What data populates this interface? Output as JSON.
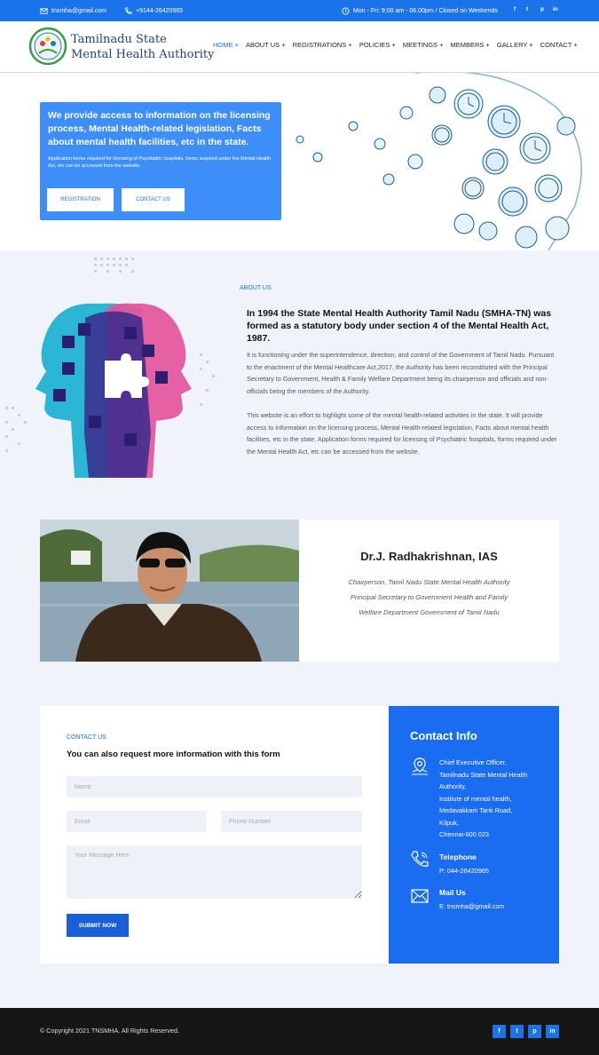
{
  "topbar": {
    "email": "tnsmha@gmail.com",
    "phone": "+9144-26420965",
    "hours": "Mon - Fri: 9:00 am - 06.00pm / Closed on Weekends",
    "social": [
      "f",
      "t",
      "p",
      "in"
    ]
  },
  "header": {
    "brand_line1": "Tamilnadu State",
    "brand_line2": "Mental Health Authority",
    "nav": [
      "HOME +",
      "ABOUT US +",
      "REGISTRATIONS +",
      "POLICIES +",
      "MEETINGS +",
      "MEMBERS +",
      "GALLERY +",
      "CONTACT +"
    ]
  },
  "hero": {
    "heading": "We provide access to information on the licensing process, Mental Health-related legislation, Facts about mental health facilities, etc in the state.",
    "text": "Application forms required for licensing of Psychiatric hospitals, forms required under the Mental Health Act, etc can be accessed from the website.",
    "btn_registration": "REGISTRATION",
    "btn_contact": "CONTACT US"
  },
  "about": {
    "subtitle": "ABOUT US",
    "heading": "In 1994 the State Mental Health Authority Tamil Nadu (SMHA-TN) was formed as a statutory body under section 4 of the Mental Health Act, 1987.",
    "para1": "It is functioning under the superintendence, direction, and control of the Government of Tamil Nadu. Pursuant to the enactment of the Mental Healthcare Act,2017, the Authority has been reconstituted with the Principal Secretary to Government, Health & Family Welfare Department being its chairperson and officials and non-officials being the members of the Authority.",
    "para2": "This website is an effort to highlight some of the mental health-related activities in the state. It will provide access to information on the licensing process, Mental Health-related legislation, Facts about mental health facilities, etc in the state. Application forms required for licensing of Psychiatric hospitals, forms required under the Mental Health Act, etc can be accessed from the website."
  },
  "person": {
    "name": "Dr.J. Radhakrishnan, IAS",
    "role1": "Chairperson, Tamil Nadu State Mental Health Authority",
    "role2": "Principal Secretary to Government Health and Family",
    "role3": "Welfare Department Government of Tamil Nadu"
  },
  "contact_form": {
    "subtitle": "CONTACT US",
    "heading": "You can also request more information with this form",
    "name_placeholder": "Name",
    "email_placeholder": "Email",
    "phone_placeholder": "Phone Number",
    "message_placeholder": "Your Message Here",
    "submit": "SUBMIT NOW"
  },
  "contact_info": {
    "title": "Contact Info",
    "address": [
      "Chief Executive Officer,",
      "Tamilnadu State Mental Health",
      "Authority,",
      "Institute of mental health,",
      "Medavakkam Tank Road,",
      "Kilpuk,",
      "Chennai-600 023"
    ],
    "tel_label": "Telephone",
    "tel_value": "P: 044-26420965",
    "mail_label": "Mail Us",
    "mail_value": "E: tnsmha@gmail.com"
  },
  "footer": {
    "copyright": "© Copyright 2021 TNSMHA. All Rights Reserved.",
    "social": [
      "f",
      "t",
      "p",
      "in"
    ]
  },
  "colors": {
    "primary": "#1a73e8",
    "hero_box": "#3d8ef8",
    "info_card": "#1a6cf0",
    "footer": "#161616"
  }
}
